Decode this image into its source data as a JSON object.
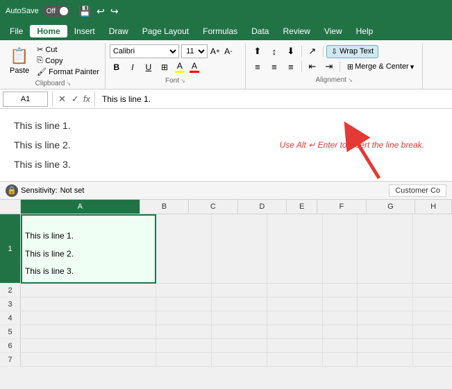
{
  "titleBar": {
    "autosave_label": "AutoSave",
    "autosave_state": "Off",
    "title": "",
    "save_icon": "💾",
    "undo_icon": "↩",
    "redo_icon": "↪"
  },
  "menuBar": {
    "items": [
      "File",
      "Home",
      "Insert",
      "Draw",
      "Page Layout",
      "Formulas",
      "Data",
      "Review",
      "View",
      "Help"
    ],
    "active": "Home"
  },
  "ribbon": {
    "clipboard": {
      "group_label": "Clipboard",
      "paste_label": "Paste",
      "cut_label": "Cut",
      "copy_label": "Copy",
      "format_painter_label": "Format Painter"
    },
    "font": {
      "group_label": "Font",
      "font_name": "Calibri",
      "font_size": "11",
      "bold_label": "B",
      "italic_label": "I",
      "underline_label": "U",
      "border_icon": "⊞",
      "fill_color_label": "A",
      "font_color_label": "A",
      "fill_color": "#FFFF00",
      "font_color": "#FF0000"
    },
    "alignment": {
      "group_label": "Alignment",
      "wrap_text_label": "Wrap Text",
      "merge_center_label": "Merge & Center",
      "align_top": "⬆",
      "align_middle": "↕",
      "align_bottom": "⬇",
      "align_left": "≡",
      "align_center": "≡",
      "align_right": "≡",
      "indent_less": "⇤",
      "indent_more": "⇥",
      "orientation": "↗"
    }
  },
  "formulaBar": {
    "cell_ref": "A1",
    "cancel_icon": "✕",
    "confirm_icon": "✓",
    "fx_label": "fx",
    "formula_content": "This is line 1.\nThis is line 2.\nThis is line 3."
  },
  "formulaPreview": {
    "line1": "This is line 1.",
    "line2": "This is line 2.",
    "line3": "This is line 3.",
    "annotation": "Use Alt ↵ Enter to insert the line break."
  },
  "sensitivityBar": {
    "label": "Sensitivity:",
    "value": "Not set",
    "customer_label": "Customer Co"
  },
  "spreadsheet": {
    "columns": [
      "A",
      "B",
      "C",
      "D",
      "E",
      "F",
      "G",
      "H"
    ],
    "selected_col": "A",
    "cell_a1_line1": "This is line 1.",
    "cell_a1_line2": "This is line 2.",
    "cell_a1_line3": "This is line 3.",
    "rows": [
      {
        "num": "1",
        "selected": true
      },
      {
        "num": "2",
        "selected": false
      },
      {
        "num": "3",
        "selected": false
      },
      {
        "num": "4",
        "selected": false
      },
      {
        "num": "5",
        "selected": false
      },
      {
        "num": "6",
        "selected": false
      },
      {
        "num": "7",
        "selected": false
      }
    ]
  }
}
